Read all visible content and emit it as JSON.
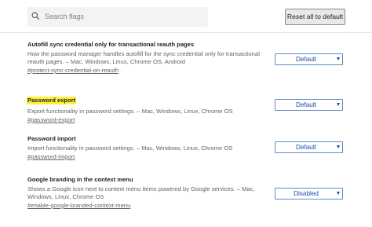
{
  "search": {
    "placeholder": "Search flags",
    "value": ""
  },
  "header": {
    "reset_label": "Reset all to default"
  },
  "flags": [
    {
      "title": "Autofill sync credential only for transactional reauth pages",
      "description": "How the password manager handles autofill for the sync credential only for transactional reauth pages. – Mac, Windows, Linux, Chrome OS, Android",
      "link": "#protect-sync-credential-on-reauth",
      "selected": "Default",
      "highlighted": false
    },
    {
      "title": "Password export",
      "description": "Export functionality in password settings. – Mac, Windows, Linux, Chrome OS",
      "link": "#password-export",
      "selected": "Default",
      "highlighted": true
    },
    {
      "title": "Password import",
      "description": "Import functionality in password settings. – Mac, Windows, Linux, Chrome OS",
      "link": "#password-import",
      "selected": "Default",
      "highlighted": false
    },
    {
      "title": "Google branding in the context menu",
      "description": "Shows a Google icon next to context menu items powered by Google services. – Mac, Windows, Linux, Chrome OS",
      "link": "#enable-google-branded-context-menu",
      "selected": "Disabled",
      "highlighted": false
    }
  ],
  "colors": {
    "highlight": "#fef03a",
    "select_border": "#5f8dc8",
    "select_text": "#1a4ba3",
    "search_bg": "#f1f3f4"
  }
}
